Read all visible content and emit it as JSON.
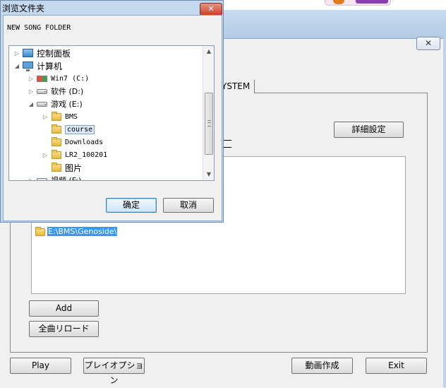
{
  "dialog": {
    "title": "浏览文件夹",
    "close_glyph": "✕",
    "description": "NEW SONG FOLDER",
    "tree": [
      {
        "label": "控制面板",
        "icon": "control-panel-icon",
        "expander": "▷"
      },
      {
        "label": "计算机",
        "icon": "computer-icon",
        "expander": "◢"
      },
      {
        "label": "Win7 (C:)",
        "icon": "windows-drive-icon",
        "expander": "▷"
      },
      {
        "label": "软件 (D:)",
        "icon": "drive-icon",
        "expander": "▷"
      },
      {
        "label": "游戏 (E:)",
        "icon": "drive-icon",
        "expander": "◢"
      },
      {
        "label": "BMS",
        "icon": "folder-icon",
        "expander": "▷"
      },
      {
        "label": "course",
        "icon": "folder-icon",
        "expander": ""
      },
      {
        "label": "Downloads",
        "icon": "folder-icon",
        "expander": ""
      },
      {
        "label": "LR2_100201",
        "icon": "folder-icon",
        "expander": "▷"
      },
      {
        "label": "图片",
        "icon": "folder-icon",
        "expander": ""
      },
      {
        "label": "视频 (F:)",
        "icon": "drive-icon",
        "expander": "▷"
      }
    ],
    "selected_item": "course",
    "scroll_up_glyph": "▲",
    "scroll_down_glyph": "▼",
    "ok_label": "确定",
    "cancel_label": "取消"
  },
  "app": {
    "close_glyph": "✕",
    "tab_label": "YSTEM",
    "detail_settings_label": "詳細設定",
    "folder_list": [
      "E:\\BMS\\Genoside\\"
    ],
    "add_label": "Add",
    "reload_label": "全曲リロード",
    "play_label": "Play",
    "play_options_label": "プレイオプション",
    "video_create_label": "動画作成",
    "exit_label": "Exit"
  }
}
